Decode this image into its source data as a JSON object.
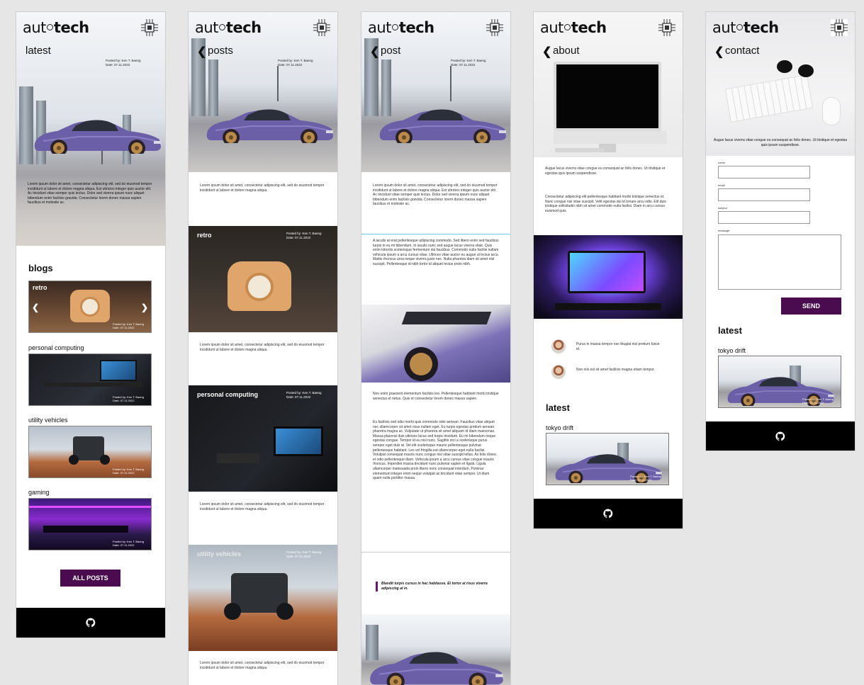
{
  "brand": {
    "logo_prefix": "aut",
    "logo_suffix": "tech"
  },
  "meta": {
    "posted": "Posted by: Ken T. Baeng",
    "date": "Date: 07.11.2022"
  },
  "lorem": {
    "short": "Lorem ipsum dolor sit amet, consectetur adipiscing elit, sed do eiusmod tempor incididunt ut labore et dolore magna aliqua.",
    "hero": "Lorem ipsum dolor sit amet, consectetur adipiscing elit, sed do eiusmod tempor incididunt ut labore et dolore magna aliqua. Est ultricies integer quis auctor elit. Ac tincidunt vitae semper quis lectus. Dolor sed viverra ipsum nunc aliquet bibendum enim facilisis gravida. Consectetur lorem donec massa sapien faucibus et molestie ac.",
    "p2": "A iaculis at erat pellentesque adipiscing commodo. Sed libero enim sed faucibus turpis in eu mi bibendum. In iaculis nunc sed augue lacus viverra vitae. Quis enim lobortis scelerisque fermentum dui faucibus. Commodo nulla facilisi nullam vehicula ipsum a arcu cursus vitae. Ultrices vitae auctor eu augue ut lectus arcu. Mattis rhoncus urna neque viverra justo nec. Nulla pharetra diam sit amet nisl suscipit. Pellentesque id nibh tortor id aliquet lectus proin nibh.",
    "p3": "Non enim praesent elementum facilisis leo. Pellentesque habitant morbi tristique senectus et netus. Quis et consectetur lorem donec massa sapien.",
    "p4": "Eu facilisis sed odio morbi quis commodo odio aenean. Faucibus vitae aliquet nec ullamcorper sit amet risus nullam eget. Eu turpis egestas pretium aenean pharetra magna ac. Vulputate ut pharetra sit amet aliquam id diam maecenas. Massa placerat duis ultricies lacus sed turpis tincidunt. Eu mi bibendum neque egestas congue. Tempor id eu nisl nunc. Sagittis orci a scelerisque purus semper eget duis at. Vel elit scelerisque mauris pellentesque pulvinar pellentesque habitant. Leo vel fringilla est ullamcorper eget nulla facilisi. Volutpat consequat mauris nunc congue nisi vitae suscipit tellus. As felis donec et odio pellentesque diam. Vehicula ipsum a arcu cursus vitae congue mauris rhoncus. Imperdiet massa tincidunt nunc pulvinar sapien et ligula. Ligula ullamcorper malesuada proin libero nunc consequat interdum. Pulvinar elementum integer enim neque volutpat ac tincidunt vitae semper. Ut diam quam nulla porttitor massa.",
    "quote": "Blandit turpis cursus in hac habitasse. Et tortor at risus viverra adipiscing at in.",
    "about1": "Augue lacus viverra vitae congue eu consequat ac felis donec. Ut tristique et egestas quis ipsum suspendisse.",
    "about2": "Consectetur adipiscing elit pellentesque habitant morbi tristique senectus et. Nunc congue nisi vitae suscipit. Velit egestas dui id ornare arcu odio. Elit duis tristique sollicitudin nibh sit amet commodo nulla facilisi. Diam in arcu cursus euismod quis.",
    "team1": "Purus in massa tempor nec feugiat nisl pretium fusce id.",
    "team2": "Non nisi est sit amet facilisis magna etiam tempor.",
    "contact": "Augue lacus viverra vitae congue eu consequat ac felis donec. Ut tristique et egestas quis ipsum suspendisse."
  },
  "screen_home": {
    "title": "latest",
    "blogs_heading": "blogs",
    "carousel_label": "retro",
    "categories": [
      "personal computing",
      "utility vehicles",
      "gaming"
    ],
    "all_posts": "ALL POSTS"
  },
  "screen_posts": {
    "title": "posts",
    "sections": [
      "retro",
      "personal computing",
      "utility vehicles"
    ]
  },
  "screen_post": {
    "title": "post"
  },
  "screen_about": {
    "title": "about",
    "latest": "latest",
    "latest_item": "tokyo drift"
  },
  "screen_contact": {
    "title": "contact",
    "labels": [
      "name",
      "email",
      "subject",
      "message"
    ],
    "send": "SEND",
    "latest": "latest",
    "latest_item": "tokyo drift"
  },
  "colors": {
    "accent": "#4a0c4e",
    "footer": "#000000",
    "car": "#6b5fa8"
  }
}
